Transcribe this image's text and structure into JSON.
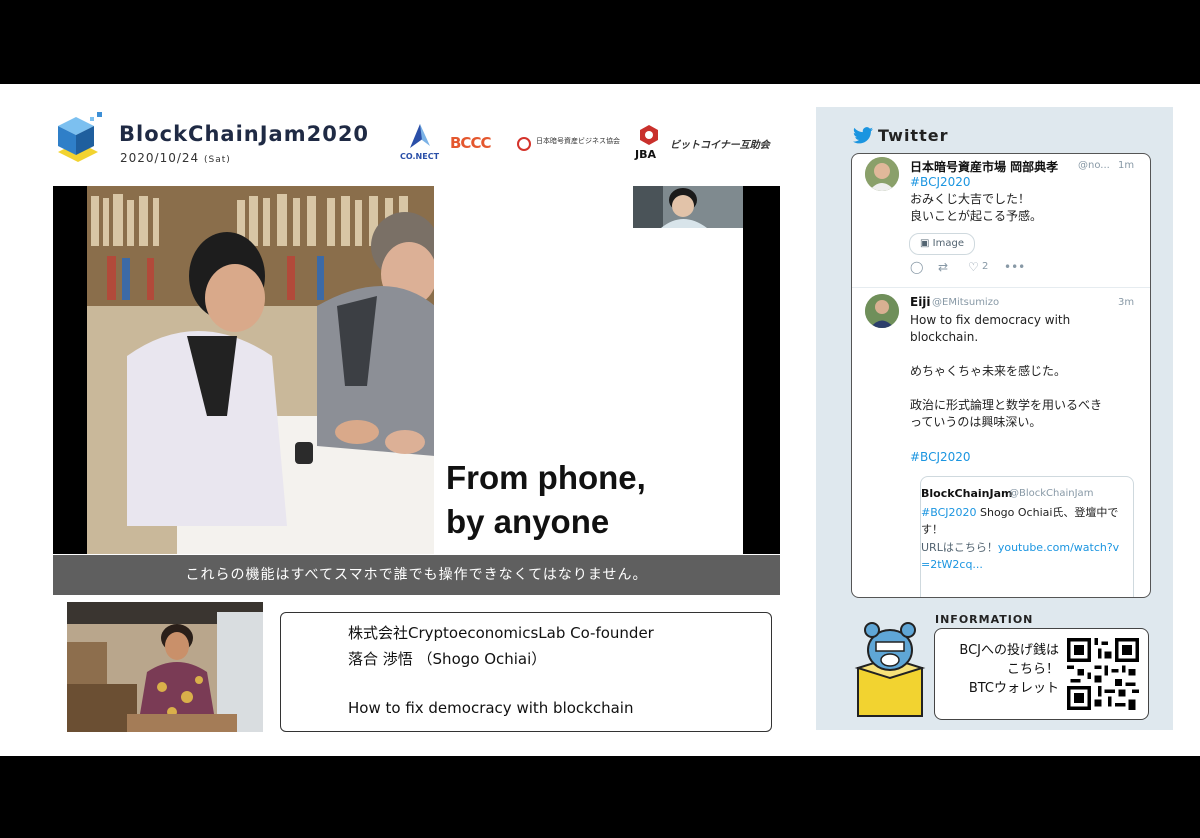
{
  "header": {
    "title": "BlockChainJam2020",
    "date": "2020/10/24",
    "day": "(Sat)"
  },
  "sponsors": [
    "CO.NECT",
    "BCCC",
    "日本暗号資産ビジネス協会",
    "JBA",
    "ビットコイナー互助会"
  ],
  "slide": {
    "caption": "From phone,\nby anyone",
    "subtitle": "これらの機能はすべてスマホで誰でも操作できなくてはなりません。"
  },
  "speaker": {
    "affiliation": "株式会社CryptoeconomicsLab Co-founder",
    "name": "落合 渉悟 （Shogo Ochiai）",
    "talk_title": "How to fix democracy with blockchain"
  },
  "twitter": {
    "heading": "Twitter",
    "tweets": [
      {
        "name": "日本暗号資産市場 岡部典孝",
        "handle": "@no...",
        "time": "1m",
        "hashtag": "#BCJ2020",
        "text": "おみくじ大吉でした！\n良いことが起こる予感。",
        "image_chip": "Image",
        "likes": "2"
      },
      {
        "name": "Eiji",
        "handle": "@EMitsumizo",
        "time": "3m",
        "text": "How to fix democracy with\nblockchain.\n\nめちゃくちゃ未来を感じた。\n\n政治に形式論理と数学を用いるべき\nっていうのは興味深い。",
        "hashtag": "#BCJ2020",
        "quoted": {
          "name": "BlockChainJam",
          "handle": "@BlockChainJam",
          "hashtag": "#BCJ2020",
          "text": " Shogo Ochiai氏、登壇中です！",
          "url_prefix": "URLはこちら！",
          "url": "youtube.com/watch?v=2tW2cq..."
        }
      }
    ]
  },
  "information": {
    "label": "INFORMATION",
    "text": "BCJへの投げ銭は\nこちら！\nBTCウォレット"
  },
  "colors": {
    "brand_navy": "#1f2a44",
    "cube_blue": "#3d8fd6",
    "cube_yellow": "#f2d330",
    "twitter_blue": "#1b95e0",
    "panel_bg": "#dfe8ee",
    "subtitle_bg": "#5f5f5f"
  },
  "icons": [
    "blockchainjam-cube-logo",
    "twitter-bird-icon",
    "reply-icon",
    "retweet-icon",
    "like-icon",
    "more-icon",
    "image-icon",
    "qr-code",
    "mascot-bear"
  ]
}
